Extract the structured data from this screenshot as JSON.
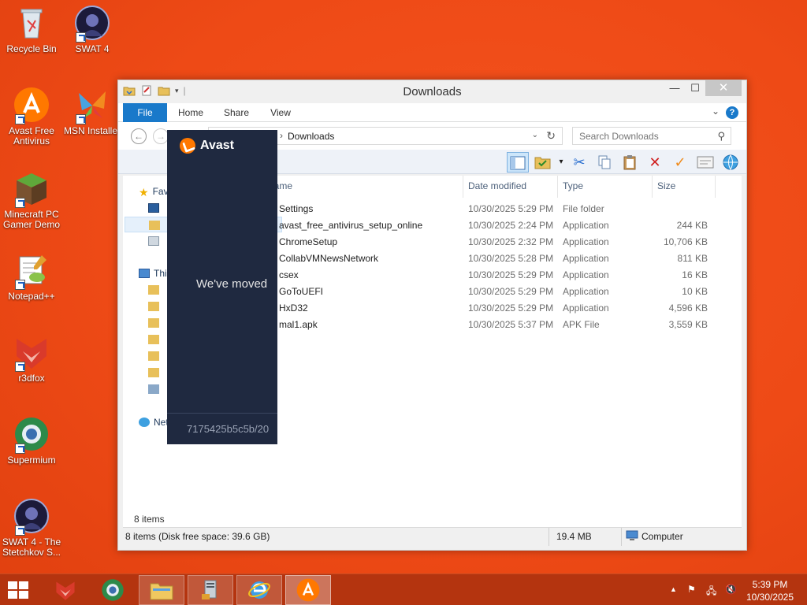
{
  "desktop": {
    "icons": [
      {
        "label": "Recycle Bin"
      },
      {
        "label": "SWAT 4"
      },
      {
        "label": "Avast Free Antivirus"
      },
      {
        "label": "MSN Installer"
      },
      {
        "label": "Minecraft PC Gamer Demo"
      },
      {
        "label": "Notepad++"
      },
      {
        "label": "r3dfox"
      },
      {
        "label": "Supermium"
      },
      {
        "label": "SWAT 4 - The Stetchkov S..."
      }
    ]
  },
  "window": {
    "title": "Downloads",
    "minimize": "—",
    "maximize": "☐",
    "close": "✕",
    "ribbon": {
      "file": "File",
      "home": "Home",
      "share": "Share",
      "view": "View"
    },
    "address": {
      "path": "Downloads",
      "search_placeholder": "Search Downloads"
    },
    "columns": {
      "name": "Name",
      "date": "Date modified",
      "type": "Type",
      "size": "Size"
    },
    "files": [
      {
        "name": "Settings",
        "date": "10/30/2025 5:29 PM",
        "type": "File folder",
        "size": ""
      },
      {
        "name": "avast_free_antivirus_setup_online",
        "date": "10/30/2025 2:24 PM",
        "type": "Application",
        "size": "244 KB"
      },
      {
        "name": "ChromeSetup",
        "date": "10/30/2025 2:32 PM",
        "type": "Application",
        "size": "10,706 KB"
      },
      {
        "name": "CollabVMNewsNetwork",
        "date": "10/30/2025 5:28 PM",
        "type": "Application",
        "size": "811 KB"
      },
      {
        "name": "csex",
        "date": "10/30/2025 5:29 PM",
        "type": "Application",
        "size": "16 KB"
      },
      {
        "name": "GoToUEFI",
        "date": "10/30/2025 5:29 PM",
        "type": "Application",
        "size": "10 KB"
      },
      {
        "name": "HxD32",
        "date": "10/30/2025 5:29 PM",
        "type": "Application",
        "size": "4,596 KB"
      },
      {
        "name": "mal1.apk",
        "date": "10/30/2025 5:37 PM",
        "type": "APK File",
        "size": "3,559 KB"
      }
    ],
    "nav": {
      "favorites": "Favorites",
      "this_pc": "This PC",
      "network": "Network"
    },
    "items_count": "8 items",
    "status": {
      "left": "8 items (Disk free space: 39.6 GB)",
      "size": "19.4 MB",
      "location": "Computer"
    }
  },
  "avast_overlay": {
    "brand": "Avast",
    "message": "We've moved",
    "id_text": "7175425b5c5b/20"
  },
  "taskbar": {
    "time": "5:39 PM",
    "date": "10/30/2025"
  }
}
